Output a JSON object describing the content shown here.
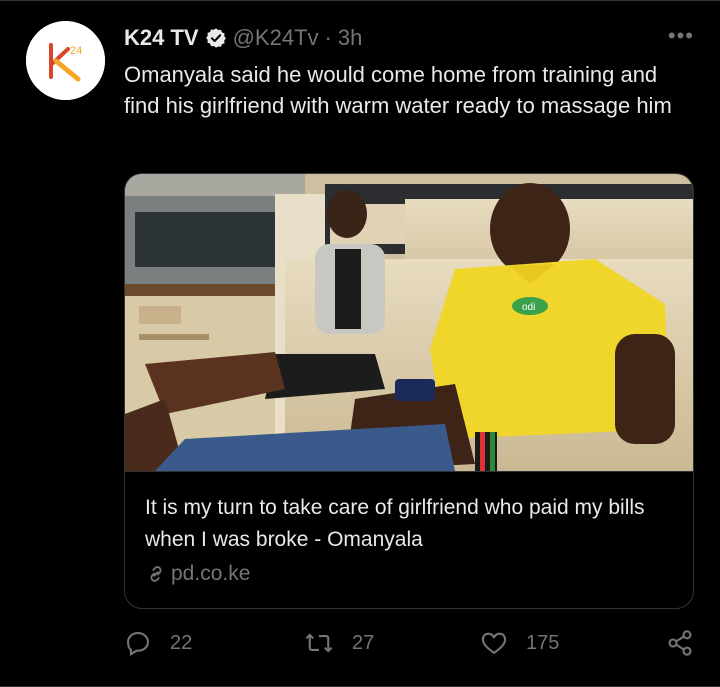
{
  "author": {
    "name": "K24 TV",
    "handle": "@K24Tv",
    "time": "3h",
    "verified_icon": "verified-badge-icon",
    "avatar_logo_text": "24"
  },
  "tweet": {
    "text": "Omanyala said he would come home from training and find his girlfriend with warm water ready to massage him"
  },
  "card": {
    "title": "It is my turn to take care of girlfriend who paid my bills when I was broke - Omanyala",
    "domain": "pd.co.ke",
    "shirt_logo_text": "odi"
  },
  "actions": {
    "replies": "22",
    "retweets": "27",
    "likes": "175"
  },
  "colors": {
    "background": "#000000",
    "text": "#e7e9ea",
    "muted": "#71767b",
    "border": "#2f3336",
    "logo_accent": "#f5a623"
  }
}
